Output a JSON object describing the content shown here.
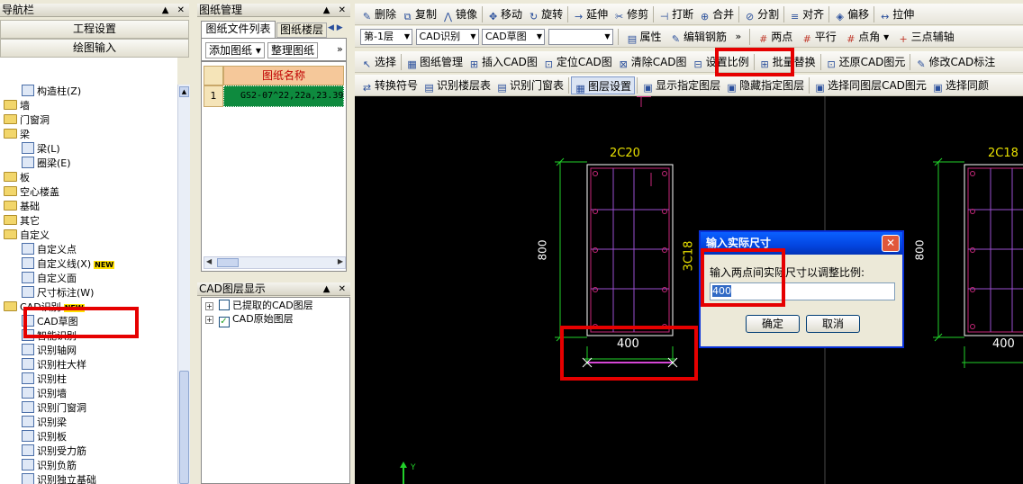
{
  "nav": {
    "title": "导航栏",
    "pin": "▲",
    "close": "✕",
    "btn_project": "工程设置",
    "btn_draw": "绘图输入",
    "tree": [
      {
        "label": "构造柱(Z)",
        "type": "item"
      },
      {
        "label": "墙",
        "type": "folder"
      },
      {
        "label": "门窗洞",
        "type": "folder"
      },
      {
        "label": "梁",
        "type": "folder"
      },
      {
        "label": "梁(L)",
        "type": "item"
      },
      {
        "label": "圈梁(E)",
        "type": "item"
      },
      {
        "label": "板",
        "type": "folder"
      },
      {
        "label": "空心楼盖",
        "type": "folder"
      },
      {
        "label": "基础",
        "type": "folder"
      },
      {
        "label": "其它",
        "type": "folder"
      },
      {
        "label": "自定义",
        "type": "folder"
      },
      {
        "label": "自定义点",
        "type": "item"
      },
      {
        "label": "自定义线(X)",
        "type": "item",
        "badge": "NEW"
      },
      {
        "label": "自定义面",
        "type": "item"
      },
      {
        "label": "尺寸标注(W)",
        "type": "item"
      },
      {
        "label": "CAD识别",
        "type": "folder",
        "badge": "NEW"
      },
      {
        "label": "CAD草图",
        "type": "item"
      },
      {
        "label": "智能识别",
        "type": "item"
      },
      {
        "label": "识别轴网",
        "type": "item"
      },
      {
        "label": "识别柱大样",
        "type": "item"
      },
      {
        "label": "识别柱",
        "type": "item"
      },
      {
        "label": "识别墙",
        "type": "item"
      },
      {
        "label": "识别门窗洞",
        "type": "item"
      },
      {
        "label": "识别梁",
        "type": "item"
      },
      {
        "label": "识别板",
        "type": "item"
      },
      {
        "label": "识别受力筋",
        "type": "item"
      },
      {
        "label": "识别负筋",
        "type": "item"
      },
      {
        "label": "识别独立基础",
        "type": "item"
      }
    ]
  },
  "drawings": {
    "title": "图纸管理",
    "tab_files": "图纸文件列表",
    "tab_floors": "图纸楼层",
    "btn_add": "添加图纸",
    "btn_organize": "整理图纸",
    "col_name": "图纸名称",
    "rows": [
      {
        "index": "1",
        "name": "GS2-07^22,22a,23.39"
      }
    ]
  },
  "layers": {
    "title": "CAD图层显示",
    "items": [
      {
        "label": "已提取的CAD图层",
        "checked": false
      },
      {
        "label": "CAD原始图层",
        "checked": true
      }
    ]
  },
  "toolbar1": [
    "删除",
    "复制",
    "镜像",
    "移动",
    "旋转",
    "延伸",
    "修剪",
    "打断",
    "合并",
    "分割",
    "对齐",
    "偏移",
    "拉伸"
  ],
  "toolbar2": {
    "floor": "第-1层",
    "mode": "CAD识别",
    "sub": "CAD草图",
    "buttons": [
      "属性",
      "编辑钢筋",
      "两点",
      "平行",
      "点角",
      "三点辅轴"
    ]
  },
  "toolbar3": [
    "选择",
    "图纸管理",
    "插入CAD图",
    "定位CAD图",
    "清除CAD图",
    "设置比例",
    "批量替换",
    "还原CAD图元",
    "修改CAD标注"
  ],
  "toolbar4": [
    "转换符号",
    "识别楼层表",
    "识别门窗表",
    "图层设置",
    "显示指定图层",
    "隐藏指定图层",
    "选择同图层CAD图元",
    "选择同颜"
  ],
  "canvas": {
    "col1_label": "2C20",
    "col1_side": "3C18",
    "dim_800": "800",
    "dim_400": "400",
    "col2_label": "2C18",
    "axis_y": "Y"
  },
  "dialog": {
    "title": "输入实际尺寸",
    "close": "✕",
    "prompt": "输入两点间实际尺寸以调整比例:",
    "value": "400",
    "ok": "确定",
    "cancel": "取消"
  }
}
